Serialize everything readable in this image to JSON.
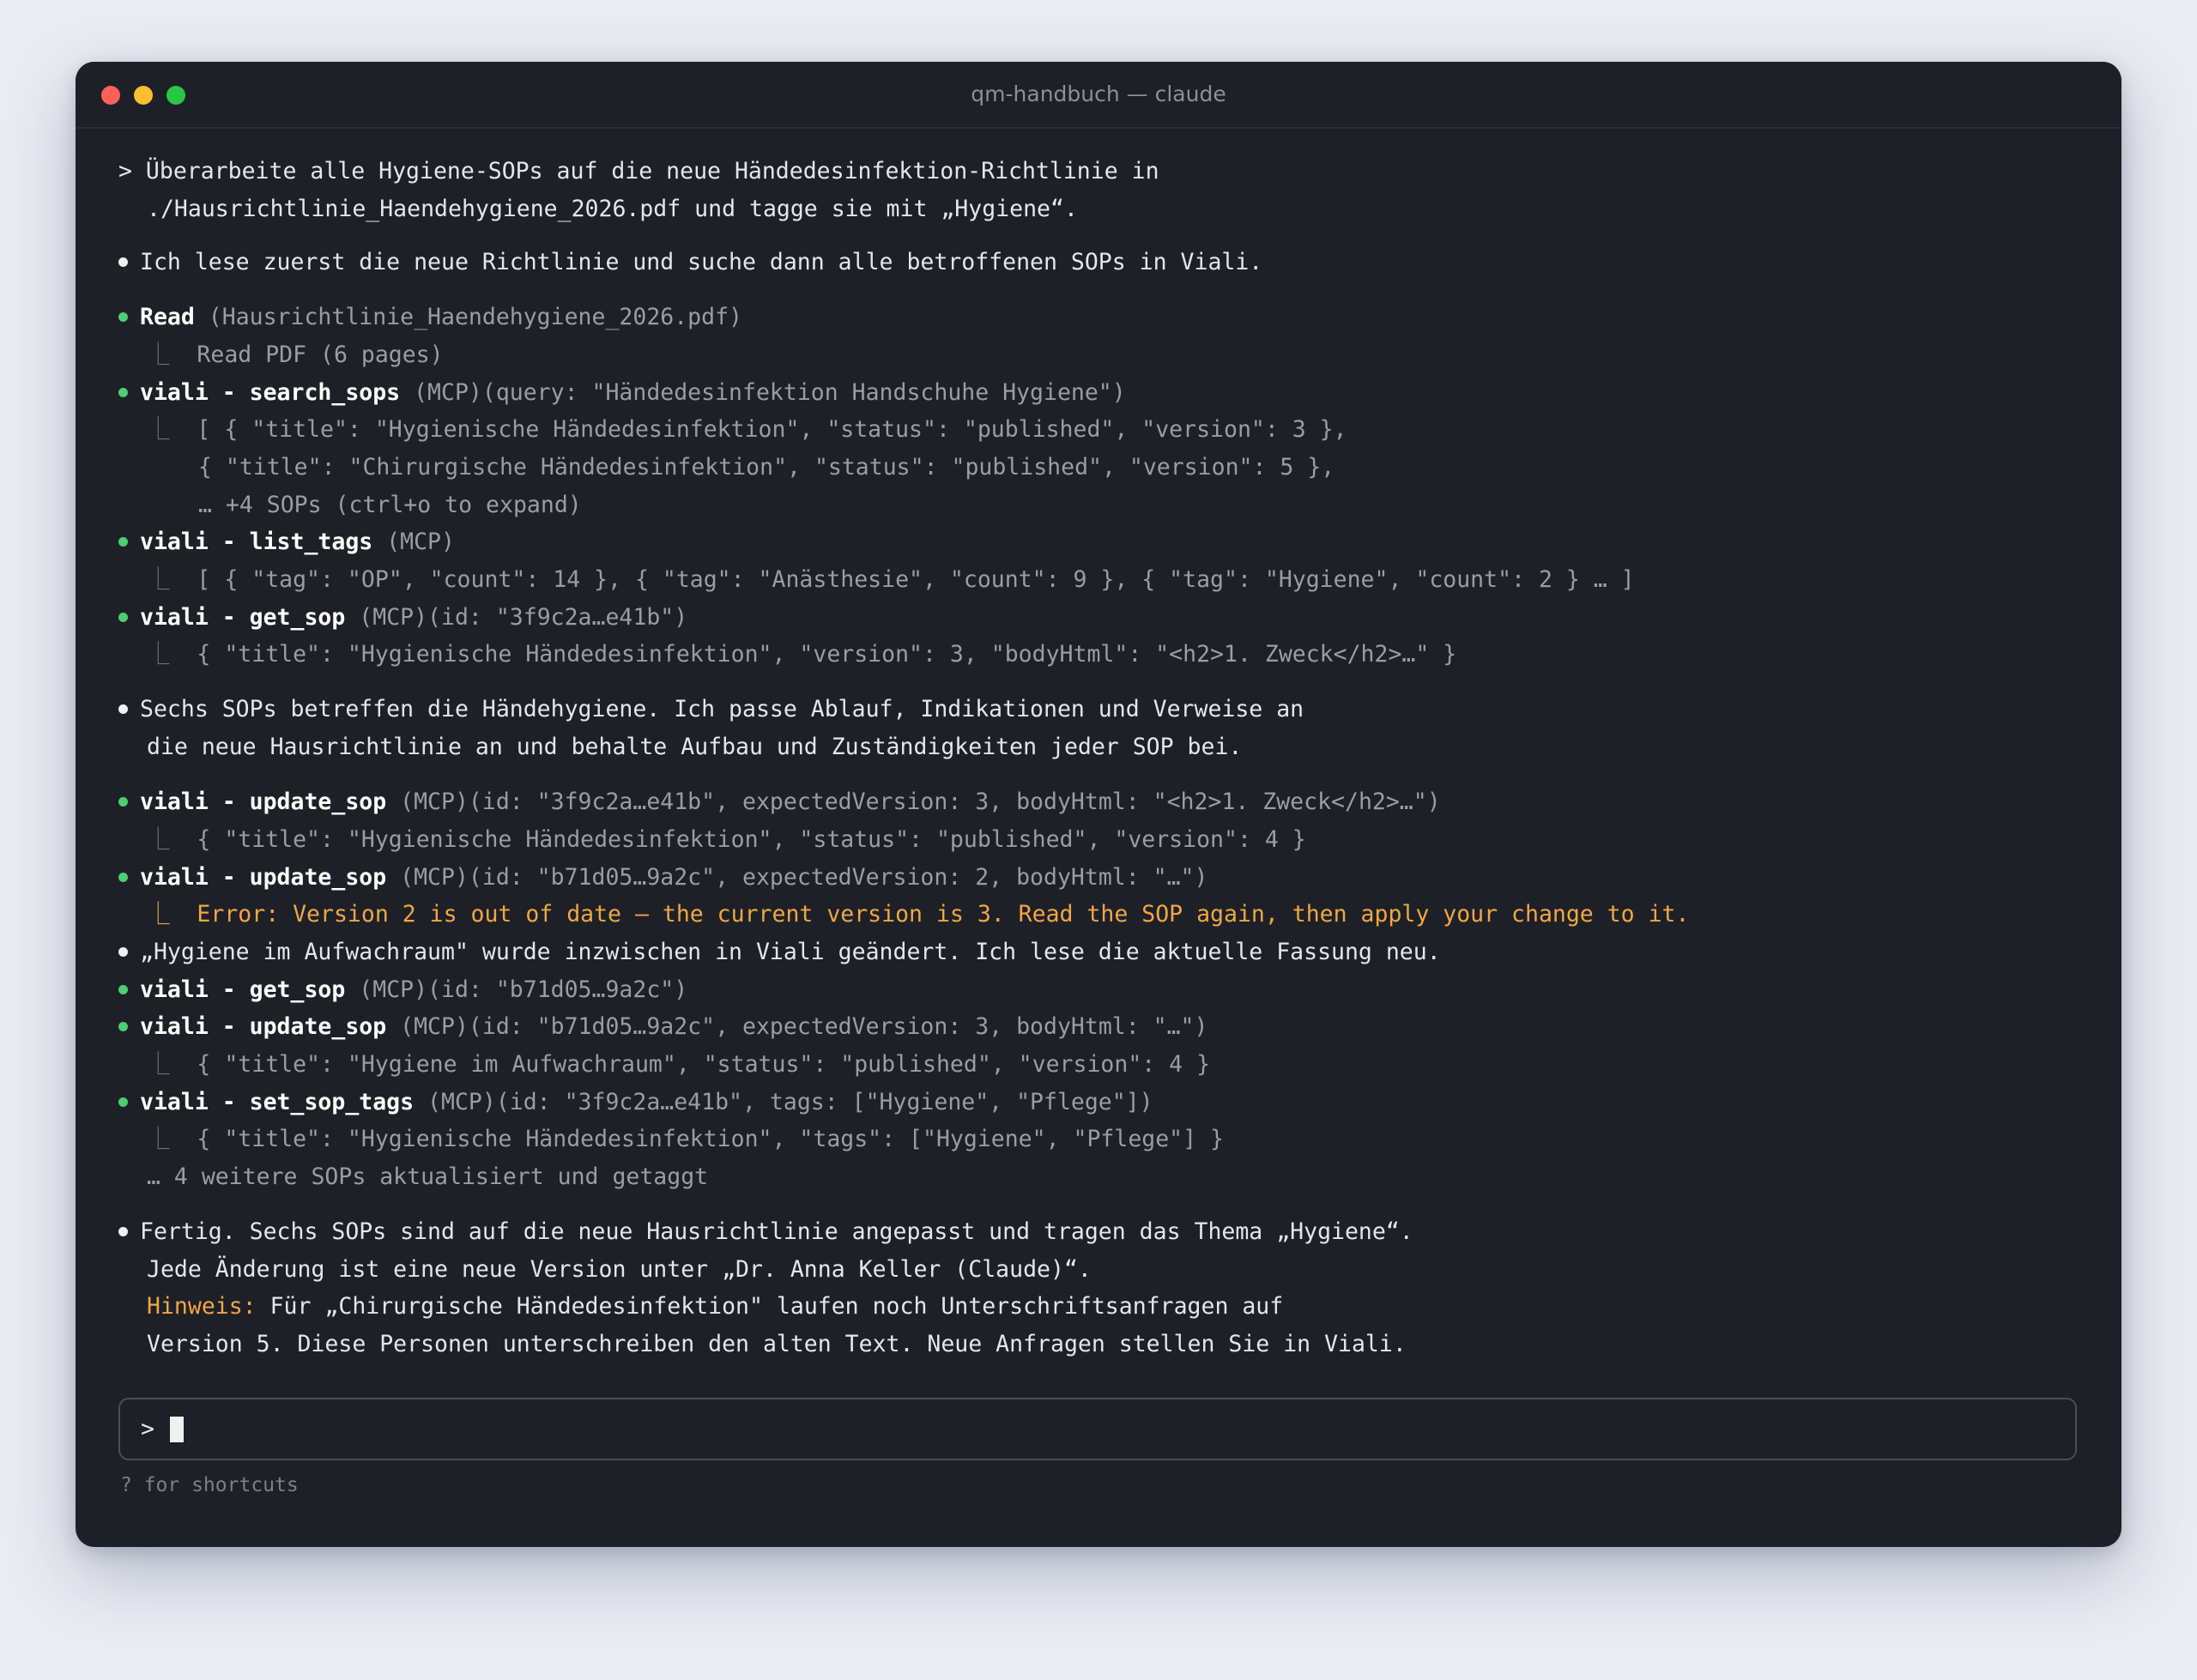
{
  "window": {
    "title": "qm-handbuch — claude"
  },
  "user_prompt": {
    "line1": "> Überarbeite alle Hygiene-SOPs auf die neue Händedesinfektion-Richtlinie in",
    "line2": "./Hausrichtlinie_Haendehygiene_2026.pdf und tagge sie mit „Hygiene“."
  },
  "msg1": "Ich lese zuerst die neue Richtlinie und suche dann alle betroffenen SOPs in Viali.",
  "read": {
    "name": "Read",
    "args": " (Hausrichtlinie_Haendehygiene_2026.pdf)",
    "result": "Read PDF (6 pages)"
  },
  "search": {
    "name": "viali - search_sops",
    "args": " (MCP)(query: \"Händedesinfektion Handschuhe Hygiene\")",
    "r1": "[ { \"title\": \"Hygienische Händedesinfektion\", \"status\": \"published\", \"version\": 3 },",
    "r2": "{ \"title\": \"Chirurgische Händedesinfektion\", \"status\": \"published\", \"version\": 5 },",
    "r3": "… +4 SOPs (ctrl+o to expand)"
  },
  "list_tags": {
    "name": "viali - list_tags",
    "args": " (MCP)",
    "result": "[ { \"tag\": \"OP\", \"count\": 14 }, { \"tag\": \"Anästhesie\", \"count\": 9 }, { \"tag\": \"Hygiene\", \"count\": 2 } … ]"
  },
  "get_sop1": {
    "name": "viali - get_sop",
    "args": " (MCP)(id: \"3f9c2a…e41b\")",
    "result": "{ \"title\": \"Hygienische Händedesinfektion\", \"version\": 3, \"bodyHtml\": \"<h2>1. Zweck</h2>…\" }"
  },
  "msg2": {
    "line1": "Sechs SOPs betreffen die Händehygiene. Ich passe Ablauf, Indikationen und Verweise an",
    "line2": "die neue Hausrichtlinie an und behalte Aufbau und Zuständigkeiten jeder SOP bei."
  },
  "update1": {
    "name": "viali - update_sop",
    "args": " (MCP)(id: \"3f9c2a…e41b\", expectedVersion: 3, bodyHtml: \"<h2>1. Zweck</h2>…\")",
    "result": "{ \"title\": \"Hygienische Händedesinfektion\", \"status\": \"published\", \"version\": 4 }"
  },
  "update2": {
    "name": "viali - update_sop",
    "args": " (MCP)(id: \"b71d05…9a2c\", expectedVersion: 2, bodyHtml: \"…\")",
    "error": "Error: Version 2 is out of date — the current version is 3. Read the SOP again, then apply your change to it."
  },
  "msg3": "„Hygiene im Aufwachraum\" wurde inzwischen in Viali geändert. Ich lese die aktuelle Fassung neu.",
  "get_sop2": {
    "name": "viali - get_sop",
    "args": " (MCP)(id: \"b71d05…9a2c\")"
  },
  "update3": {
    "name": "viali - update_sop",
    "args": " (MCP)(id: \"b71d05…9a2c\", expectedVersion: 3, bodyHtml: \"…\")",
    "result": "{ \"title\": \"Hygiene im Aufwachraum\", \"status\": \"published\", \"version\": 4 }"
  },
  "set_tags": {
    "name": "viali - set_sop_tags",
    "args": " (MCP)(id: \"3f9c2a…e41b\", tags: [\"Hygiene\", \"Pflege\"])",
    "result": "{ \"title\": \"Hygienische Händedesinfektion\", \"tags\": [\"Hygiene\", \"Pflege\"] }",
    "more": "… 4 weitere SOPs aktualisiert und getaggt"
  },
  "final": {
    "line1": "Fertig. Sechs SOPs sind auf die neue Hausrichtlinie angepasst und tragen das Thema „Hygiene“.",
    "line2": "Jede Änderung ist eine neue Version unter „Dr. Anna Keller (Claude)“.",
    "note_label": "Hinweis:",
    "line3": " Für „Chirurgische Händedesinfektion\" laufen noch Unterschriftsanfragen auf",
    "line4": "Version 5. Diese Personen unterschreiben den alten Text. Neue Anfragen stellen Sie in Viali."
  },
  "input": {
    "prompt": ">"
  },
  "hint": "? for shortcuts",
  "elbow": "⎿",
  "colors": {
    "bullet_ok": "#4ccf6e",
    "error": "#f0a742",
    "background": "#1e2028"
  }
}
